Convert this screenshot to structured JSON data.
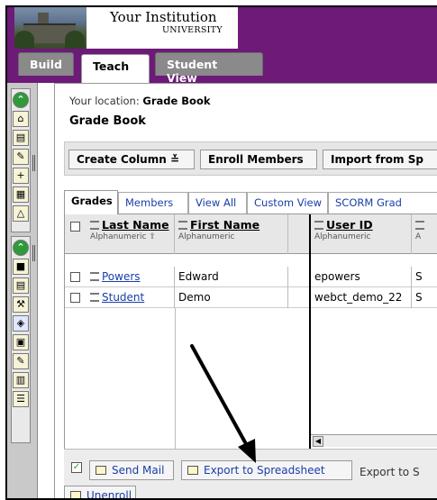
{
  "institution": {
    "name": "Your Institution",
    "sub": "UNIVERSITY"
  },
  "tabs": [
    {
      "label": "Build"
    },
    {
      "label": "Teach"
    },
    {
      "label": "Student View"
    }
  ],
  "location": {
    "prefix": "Your location:",
    "value": "Grade Book"
  },
  "page_title": "Grade Book",
  "actions": {
    "create_column": "Create Column",
    "enroll_members": "Enroll Members",
    "import_from": "Import from Sp"
  },
  "grid_tabs": [
    "Grades",
    "Members",
    "View All",
    "Custom View",
    "SCORM Grad"
  ],
  "columns": [
    {
      "title": "Last Name",
      "sub": "Alphanumeric"
    },
    {
      "title": "First Name",
      "sub": "Alphanumeric"
    },
    {
      "title": "User ID",
      "sub": "Alphanumeric"
    },
    {
      "title": "",
      "sub": "A"
    }
  ],
  "rows": [
    {
      "last": "Powers",
      "first": "Edward",
      "userid": "epowers",
      "extra": "S"
    },
    {
      "last": "Student",
      "first": "Demo",
      "userid": "webct_demo_22",
      "extra": "S"
    }
  ],
  "bottom": {
    "send_mail": "Send Mail",
    "export_spreadsheet": "Export to Spreadsheet",
    "export_to": "Export to S",
    "unenroll": "Unenroll"
  }
}
